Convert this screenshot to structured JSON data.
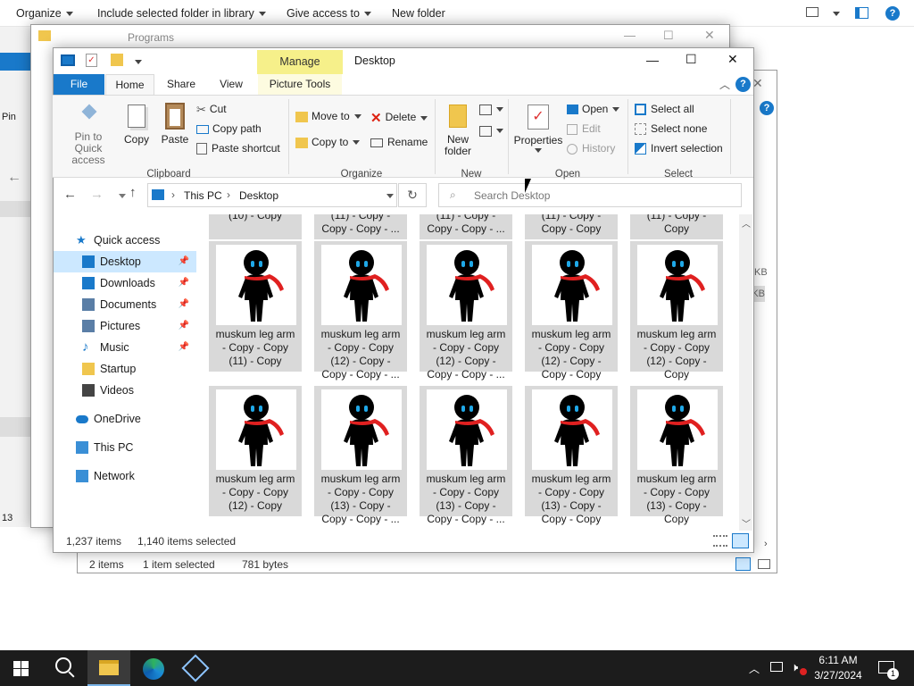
{
  "background": {
    "toolbar": [
      "Organize",
      "Include selected folder in library",
      "Give access to",
      "New folder"
    ],
    "win_title": "Programs",
    "status_items": "2 items",
    "status_sel": "1 item selected",
    "status_size": "781 bytes",
    "left_frag": [
      "Pin",
      "13"
    ],
    "right_frag": [
      "KB",
      "KB"
    ]
  },
  "window": {
    "title": "Desktop",
    "manage_label": "Manage",
    "minimize": "—",
    "maximize": "☐",
    "close": "✕"
  },
  "tabs": [
    "File",
    "Home",
    "Share",
    "View",
    "Picture Tools"
  ],
  "ribbon": {
    "clipboard": {
      "pin": "Pin to Quick access",
      "copy": "Copy",
      "paste": "Paste",
      "cut": "Cut",
      "copy_path": "Copy path",
      "paste_shortcut": "Paste shortcut",
      "label": "Clipboard"
    },
    "organize": {
      "move_to": "Move to",
      "copy_to": "Copy to",
      "delete": "Delete",
      "rename": "Rename",
      "label": "Organize"
    },
    "new": {
      "new_folder": "New folder",
      "label": "New"
    },
    "open": {
      "properties": "Properties",
      "open": "Open",
      "edit": "Edit",
      "history": "History",
      "label": "Open"
    },
    "select": {
      "select_all": "Select all",
      "select_none": "Select none",
      "invert": "Invert selection",
      "label": "Select"
    }
  },
  "address": {
    "crumbs": [
      "This PC",
      "Desktop"
    ],
    "search_placeholder": "Search Desktop"
  },
  "nav": [
    {
      "label": "Quick access",
      "icon": "star-icon"
    },
    {
      "label": "Desktop",
      "icon": "desktop-icon",
      "pinned": true
    },
    {
      "label": "Downloads",
      "icon": "download-icon",
      "pinned": true
    },
    {
      "label": "Documents",
      "icon": "documents-icon",
      "pinned": true
    },
    {
      "label": "Pictures",
      "icon": "pictures-icon",
      "pinned": true
    },
    {
      "label": "Music",
      "icon": "music-icon",
      "pinned": true
    },
    {
      "label": "Startup",
      "icon": "folder-icon"
    },
    {
      "label": "Videos",
      "icon": "videos-icon"
    },
    {
      "label": "OneDrive",
      "icon": "cloud-icon"
    },
    {
      "label": "This PC",
      "icon": "pc-icon"
    },
    {
      "label": "Network",
      "icon": "network-icon"
    }
  ],
  "files": {
    "top_row": [
      "(10) - Copy",
      "(11) - Copy -\nCopy - Copy - ...",
      "(11) - Copy -\nCopy - Copy - ...",
      "(11) - Copy -\nCopy - Copy",
      "(11) - Copy -\nCopy"
    ],
    "row1": [
      "muskum leg arm\n- Copy - Copy\n(11) - Copy",
      "muskum leg arm\n- Copy - Copy\n(12) - Copy -\nCopy - Copy - ...",
      "muskum leg arm\n- Copy - Copy\n(12) - Copy -\nCopy - Copy - ...",
      "muskum leg arm\n- Copy - Copy\n(12) - Copy -\nCopy - Copy",
      "muskum leg arm\n- Copy - Copy\n(12) - Copy -\nCopy"
    ],
    "row2": [
      "muskum leg arm\n- Copy - Copy\n(12) - Copy",
      "muskum leg arm\n- Copy - Copy\n(13) - Copy -\nCopy - Copy - ...",
      "muskum leg arm\n- Copy - Copy\n(13) - Copy -\nCopy - Copy - ...",
      "muskum leg arm\n- Copy - Copy\n(13) - Copy -\nCopy - Copy",
      "muskum leg arm\n- Copy - Copy\n(13) - Copy -\nCopy"
    ]
  },
  "status": {
    "items": "1,237 items",
    "selected": "1,140 items selected"
  },
  "taskbar": {
    "time": "6:11 AM",
    "date": "3/27/2024",
    "notifications": "1"
  },
  "colors": {
    "accent": "#1979ca",
    "manage_tab": "#f6f08a",
    "selection": "#cce8ff"
  }
}
